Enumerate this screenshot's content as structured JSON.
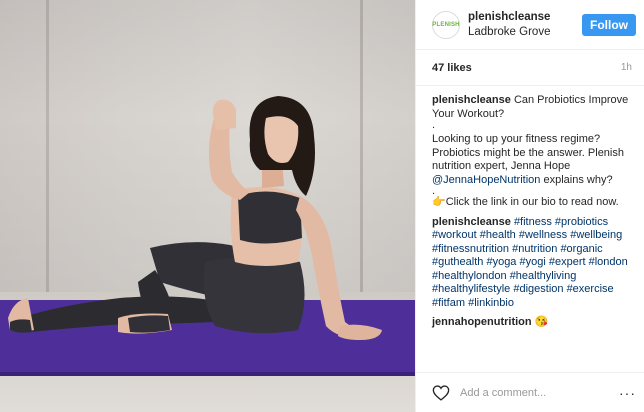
{
  "post": {
    "username": "plenishcleanse",
    "location": "Ladbroke Grove",
    "avatar_text": "PLENISH",
    "follow_label": "Follow",
    "likes": "47 likes",
    "time": "1h",
    "caption": {
      "username": "plenishcleanse",
      "line1": "Can Probiotics Improve Your Workout?",
      "dot1": ".",
      "line2_a": "Looking to up your fitness regime? Probiotics might be the answer. Plenish nutrition expert, Jenna Hope ",
      "mention": "@JennaHopeNutrition",
      "line2_b": " explains why?",
      "dot2": ".",
      "cta": "👉Click the link in our bio to read now."
    },
    "tags_comment": {
      "username": "plenishcleanse",
      "hashtags": [
        "#fitness",
        "#probiotics",
        "#workout",
        "#health",
        "#wellness",
        "#wellbeing",
        "#fitnessnutrition",
        "#nutrition",
        "#organic",
        "#guthealth",
        "#yoga",
        "#yogi",
        "#expert",
        "#london",
        "#healthylondon",
        "#healthyliving",
        "#healthylifestyle",
        "#digestion",
        "#exercise",
        "#fitfam",
        "#linkinbio"
      ]
    },
    "reply": {
      "username": "jennahopenutrition",
      "emoji": "😘"
    },
    "comment_placeholder": "Add a comment...",
    "more_label": "···"
  },
  "colors": {
    "follow_button": "#3897f0",
    "hashtag": "#003569",
    "mat": "#4e2f9a"
  },
  "icons": [
    "heart-icon",
    "more-options-icon"
  ]
}
